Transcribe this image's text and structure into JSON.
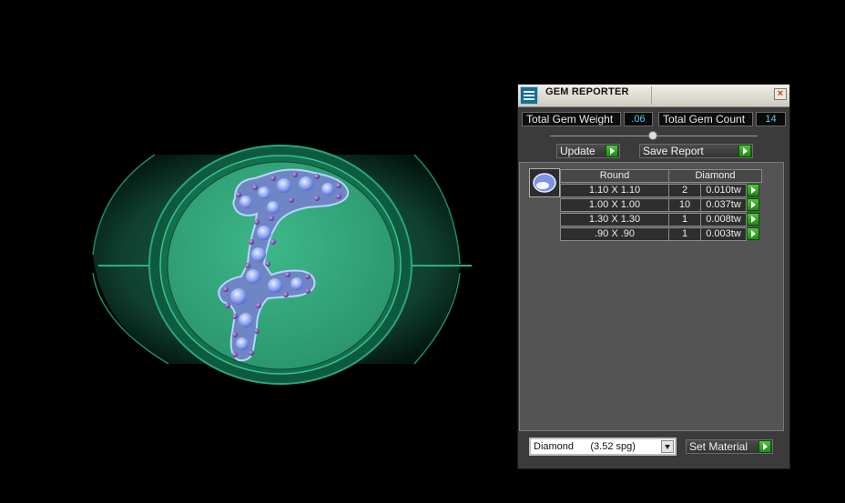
{
  "panel": {
    "title": "GEM REPORTER",
    "total_gem_weight": {
      "label": "Total Gem Weight",
      "value": ".06"
    },
    "total_gem_count": {
      "label": "Total Gem Count",
      "value": "14"
    },
    "update_label": "Update",
    "save_report_label": "Save Report",
    "gem_table": {
      "headers": [
        "Round",
        "Diamond"
      ],
      "rows": [
        {
          "size": "1.10 X 1.10",
          "count": "2",
          "weight": "0.010tw"
        },
        {
          "size": "1.00 X 1.00",
          "count": "10",
          "weight": "0.037tw"
        },
        {
          "size": "1.30 X 1.30",
          "count": "1",
          "weight": "0.008tw"
        },
        {
          "size": ".90 X .90",
          "count": "1",
          "weight": "0.003tw"
        }
      ]
    },
    "material_select": {
      "value": "Diamond      (3.52 spg)"
    },
    "set_material_label": "Set Material"
  },
  "icons": {
    "app": "gem-reporter-icon",
    "close": "close-icon",
    "go": "play-arrow-icon",
    "gem": "round-gem-icon",
    "dropdown": "chevron-down-icon"
  },
  "colors": {
    "ring_green": "#35a47e",
    "value_text": "#5ec8f0",
    "go_button": "#2fa822"
  }
}
